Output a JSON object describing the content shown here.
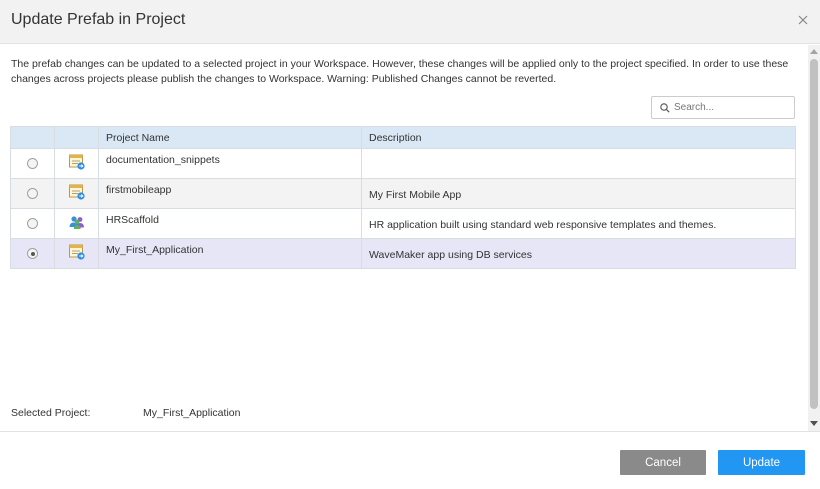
{
  "dialog": {
    "title": "Update Prefab in Project",
    "close_icon": "close-icon"
  },
  "info_text": "The prefab changes can be updated to a selected project in your Workspace. However, these changes will be applied only to the project specified. In order to use these changes across projects please publish the changes to Workspace. Warning: Published Changes cannot be reverted.",
  "search": {
    "placeholder": "Search...",
    "value": "",
    "icon": "search-icon"
  },
  "table": {
    "columns": [
      "",
      "",
      "Project Name",
      "Description"
    ],
    "rows": [
      {
        "selected": false,
        "icon": "app-icon",
        "name": "documentation_snippets",
        "description": ""
      },
      {
        "selected": false,
        "icon": "app-icon",
        "name": "firstmobileapp",
        "description": "My First Mobile App"
      },
      {
        "selected": false,
        "icon": "people-icon",
        "name": "HRScaffold",
        "description": "HR application built using standard web responsive templates and themes."
      },
      {
        "selected": true,
        "icon": "app-icon",
        "name": "My_First_Application",
        "description": "WaveMaker app using DB services"
      }
    ]
  },
  "selected_project": {
    "label": "Selected Project:",
    "value": "My_First_Application"
  },
  "footer": {
    "cancel_label": "Cancel",
    "update_label": "Update"
  },
  "colors": {
    "header_bg": "#f2f2f2",
    "table_header_bg": "#d9e8f4",
    "selected_row_bg": "#e6e6f6",
    "cancel_bg": "#8a8a8a",
    "update_bg": "#2196f3"
  }
}
